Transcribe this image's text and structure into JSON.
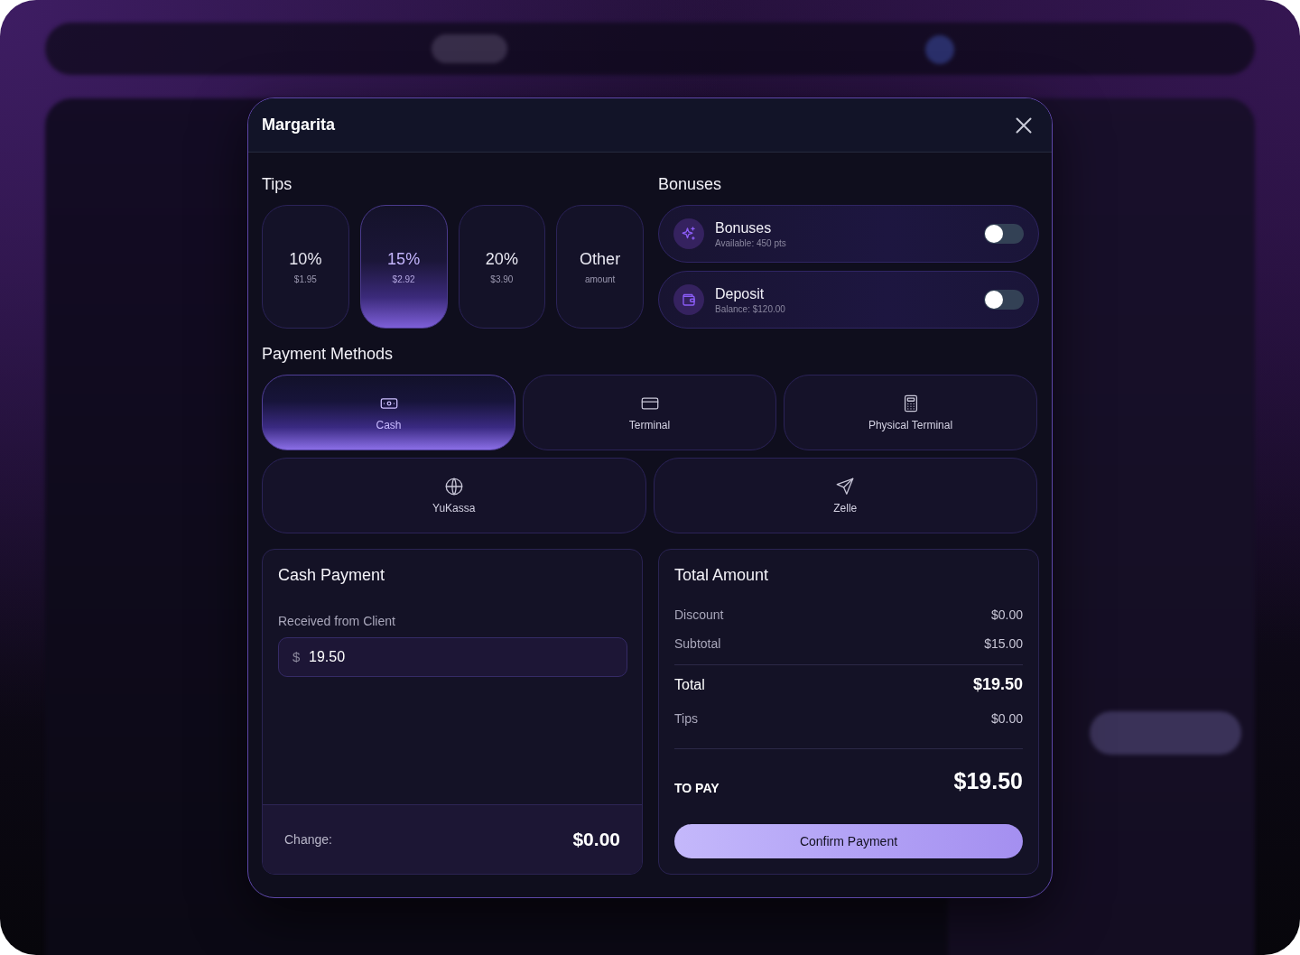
{
  "modal": {
    "title": "Margarita"
  },
  "tips": {
    "heading": "Tips",
    "options": [
      {
        "label": "10%",
        "amount": "$1.95",
        "selected": false
      },
      {
        "label": "15%",
        "amount": "$2.92",
        "selected": true
      },
      {
        "label": "20%",
        "amount": "$3.90",
        "selected": false
      },
      {
        "label": "Other",
        "amount": "amount",
        "selected": false
      }
    ]
  },
  "bonuses": {
    "heading": "Bonuses",
    "items": [
      {
        "kind": "points",
        "title": "Bonuses",
        "detail": "Available: 450 pts",
        "on": false
      },
      {
        "kind": "wallet",
        "title": "Deposit",
        "detail": "Balance: $120.00",
        "on": false
      }
    ]
  },
  "payment_methods": {
    "heading": "Payment Methods",
    "rows": [
      {
        "items": [
          {
            "kind": "cash",
            "label": "Cash",
            "selected": true
          },
          {
            "kind": "card",
            "label": "Terminal",
            "selected": false
          },
          {
            "kind": "calculator",
            "label": "Physical Terminal",
            "selected": false
          }
        ]
      },
      {
        "items": [
          {
            "kind": "globe",
            "label": "YuKassa",
            "selected": false
          },
          {
            "kind": "send",
            "label": "Zelle",
            "selected": false
          }
        ]
      }
    ]
  },
  "cash_payment": {
    "title": "Cash Payment",
    "field_label": "Received from Client",
    "currency": "$",
    "value": "19.50",
    "change_label": "Change:",
    "change": "$0.00"
  },
  "total_amount": {
    "title": "Total Amount",
    "rows": [
      {
        "kind": "line",
        "label": "Discount",
        "value": "$0.00"
      },
      {
        "kind": "line",
        "label": "Subtotal",
        "value": "$15.00"
      },
      {
        "kind": "total",
        "label": "Total",
        "value": "$19.50"
      },
      {
        "kind": "line",
        "label": "Tips",
        "value": "$0.00"
      }
    ],
    "to_pay_label": "TO PAY",
    "to_pay": "$19.50",
    "confirm_button": "Confirm Payment"
  }
}
